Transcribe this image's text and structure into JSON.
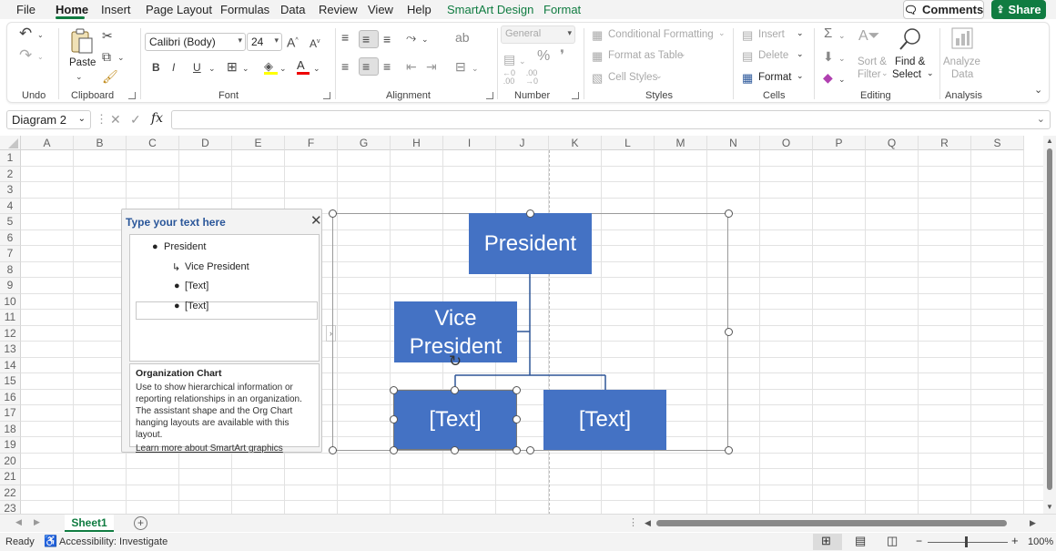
{
  "menu": {
    "tabs": [
      "File",
      "Home",
      "Insert",
      "Page Layout",
      "Formulas",
      "Data",
      "Review",
      "View",
      "Help",
      "SmartArt Design",
      "Format"
    ],
    "comments": "Comments",
    "share": "Share"
  },
  "ribbon": {
    "undo": {
      "label": "Undo"
    },
    "clipboard": {
      "label": "Clipboard",
      "paste": "Paste"
    },
    "font": {
      "label": "Font",
      "name": "Calibri (Body)",
      "size": "24",
      "bold": "B",
      "italic": "I",
      "underline": "U"
    },
    "alignment": {
      "label": "Alignment"
    },
    "number": {
      "label": "Number",
      "format": "General",
      "percent": "%",
      "comma": "❜"
    },
    "styles": {
      "label": "Styles",
      "conditional": "Conditional Formatting",
      "table": "Format as Table",
      "cellstyles": "Cell Styles"
    },
    "cells": {
      "label": "Cells",
      "insert": "Insert",
      "delete": "Delete",
      "format": "Format"
    },
    "editing": {
      "label": "Editing",
      "sort": "Sort &",
      "filter": "Filter",
      "find": "Find &",
      "select": "Select"
    },
    "analysis": {
      "label": "Analysis",
      "analyze": "Analyze",
      "data": "Data"
    }
  },
  "formula": {
    "namebox": "Diagram 2",
    "fx": "fx",
    "value": ""
  },
  "grid": {
    "columns": [
      "A",
      "B",
      "C",
      "D",
      "E",
      "F",
      "G",
      "H",
      "I",
      "J",
      "K",
      "L",
      "M",
      "N",
      "O",
      "P",
      "Q",
      "R",
      "S"
    ],
    "rows": [
      "1",
      "2",
      "3",
      "4",
      "5",
      "6",
      "7",
      "8",
      "9",
      "10",
      "11",
      "12",
      "13",
      "14",
      "15",
      "16",
      "17",
      "18",
      "19",
      "20",
      "21",
      "22",
      "23"
    ]
  },
  "textpane": {
    "title": "Type your text here",
    "items": [
      "President",
      "Vice President",
      "[Text]",
      "[Text]"
    ],
    "desc_title": "Organization Chart",
    "desc_body": "Use to show hierarchical information or reporting relationships in an organization. The assistant shape and the Org Chart hanging layouts are available with this layout.",
    "link": "Learn more about SmartArt graphics"
  },
  "smartart": {
    "president": "President",
    "vp": "Vice President",
    "text1": "[Text]",
    "text2": "[Text]",
    "fill": "#4472c4"
  },
  "sheets": {
    "active": "Sheet1"
  },
  "status": {
    "ready": "Ready",
    "accessibility": "Accessibility: Investigate",
    "zoom": "100%"
  }
}
